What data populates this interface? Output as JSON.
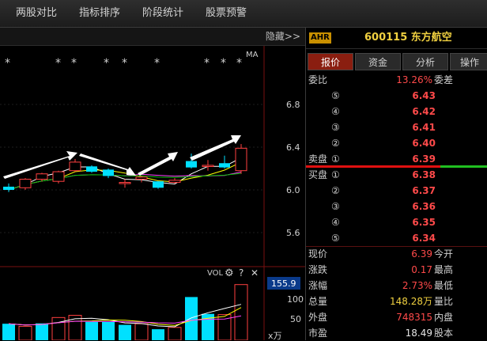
{
  "menu": [
    {
      "label": "两股对比"
    },
    {
      "label": "指标排序"
    },
    {
      "label": "阶段统计"
    },
    {
      "label": "股票预警"
    }
  ],
  "chart_header": {
    "hide_label": "隐藏",
    "hide_arrows": ">>"
  },
  "chart": {
    "ma_label": "MA",
    "markers": [
      "*",
      "*",
      "*",
      "*",
      "*",
      "*",
      "*",
      "*",
      "*",
      "*",
      "*"
    ],
    "price_axis": [
      "6.8",
      "6.4",
      "6.0",
      "5.6"
    ],
    "volume_label": "VOL",
    "volume_axis_highlight": "155.9",
    "volume_axis": [
      "100",
      "50"
    ],
    "volume_unit": "x万",
    "colors": {
      "up": "#ff4040",
      "down": "#00e0ff",
      "ma_white": "#ffffff",
      "ma_yellow": "#ffff00",
      "ma_purple": "#ff40ff",
      "ma_green": "#00c000"
    }
  },
  "chart_data": {
    "type": "candlestick",
    "ylim": [
      5.3,
      7.0
    ],
    "candles": [
      {
        "o": 6.03,
        "c": 6.0,
        "h": 6.06,
        "l": 5.98
      },
      {
        "o": 6.02,
        "c": 6.1,
        "h": 6.11,
        "l": 6.0
      },
      {
        "o": 6.1,
        "c": 6.15,
        "h": 6.16,
        "l": 6.08
      },
      {
        "o": 6.08,
        "c": 6.17,
        "h": 6.18,
        "l": 6.06
      },
      {
        "o": 6.18,
        "c": 6.26,
        "h": 6.29,
        "l": 6.17
      },
      {
        "o": 6.22,
        "c": 6.17,
        "h": 6.23,
        "l": 6.16
      },
      {
        "o": 6.19,
        "c": 6.13,
        "h": 6.2,
        "l": 6.11
      },
      {
        "o": 6.07,
        "c": 6.07,
        "h": 6.1,
        "l": 6.02
      },
      {
        "o": 6.1,
        "c": 6.12,
        "h": 6.13,
        "l": 6.07
      },
      {
        "o": 6.08,
        "c": 6.02,
        "h": 6.08,
        "l": 6.01
      },
      {
        "o": 6.07,
        "c": 6.09,
        "h": 6.11,
        "l": 6.06
      },
      {
        "o": 6.27,
        "c": 6.21,
        "h": 6.34,
        "l": 6.2
      },
      {
        "o": 6.22,
        "c": 6.23,
        "h": 6.28,
        "l": 6.18
      },
      {
        "o": 6.25,
        "c": 6.21,
        "h": 6.32,
        "l": 6.2
      },
      {
        "o": 6.18,
        "c": 6.39,
        "h": 6.43,
        "l": 6.15
      }
    ],
    "volume_ylim": [
      0,
      160
    ],
    "volume": [
      {
        "v": 45,
        "up": false
      },
      {
        "v": 38,
        "up": true
      },
      {
        "v": 46,
        "up": false
      },
      {
        "v": 62,
        "up": true
      },
      {
        "v": 68,
        "up": true
      },
      {
        "v": 50,
        "up": false
      },
      {
        "v": 50,
        "up": false
      },
      {
        "v": 42,
        "up": false
      },
      {
        "v": 45,
        "up": true
      },
      {
        "v": 30,
        "up": false
      },
      {
        "v": 35,
        "up": true
      },
      {
        "v": 118,
        "up": false
      },
      {
        "v": 72,
        "up": false
      },
      {
        "v": 70,
        "up": true
      },
      {
        "v": 152,
        "up": true
      }
    ]
  },
  "stock": {
    "tag": "AHR",
    "code_name": "600115 东方航空"
  },
  "tabs": [
    {
      "label": "报价"
    },
    {
      "label": "资金"
    },
    {
      "label": "分析"
    },
    {
      "label": "操作"
    }
  ],
  "weibi": {
    "label": "委比",
    "value": "13.26%",
    "label2": "委差"
  },
  "sell": [
    {
      "label": "",
      "circle": "⑤",
      "price": "6.43"
    },
    {
      "label": "",
      "circle": "④",
      "price": "6.42"
    },
    {
      "label": "",
      "circle": "③",
      "price": "6.41"
    },
    {
      "label": "",
      "circle": "②",
      "price": "6.40"
    },
    {
      "label": "卖盘",
      "circle": "①",
      "price": "6.39"
    }
  ],
  "buy": [
    {
      "label": "买盘",
      "circle": "①",
      "price": "6.38"
    },
    {
      "label": "",
      "circle": "②",
      "price": "6.37"
    },
    {
      "label": "",
      "circle": "③",
      "price": "6.36"
    },
    {
      "label": "",
      "circle": "④",
      "price": "6.35"
    },
    {
      "label": "",
      "circle": "⑤",
      "price": "6.34"
    }
  ],
  "stats": [
    {
      "label": "现价",
      "value": "6.39",
      "label2": "今开",
      "color": "red"
    },
    {
      "label": "涨跌",
      "value": "0.17",
      "label2": "最高",
      "color": "red"
    },
    {
      "label": "涨幅",
      "value": "2.73%",
      "label2": "最低",
      "color": "red"
    },
    {
      "label": "总量",
      "value": "148.28万",
      "label2": "量比",
      "color": "yellow"
    },
    {
      "label": "外盘",
      "value": "748315",
      "label2": "内盘",
      "color": "red"
    },
    {
      "label": "市盈",
      "value": "18.49",
      "label2": "股本",
      "color": "white"
    }
  ]
}
